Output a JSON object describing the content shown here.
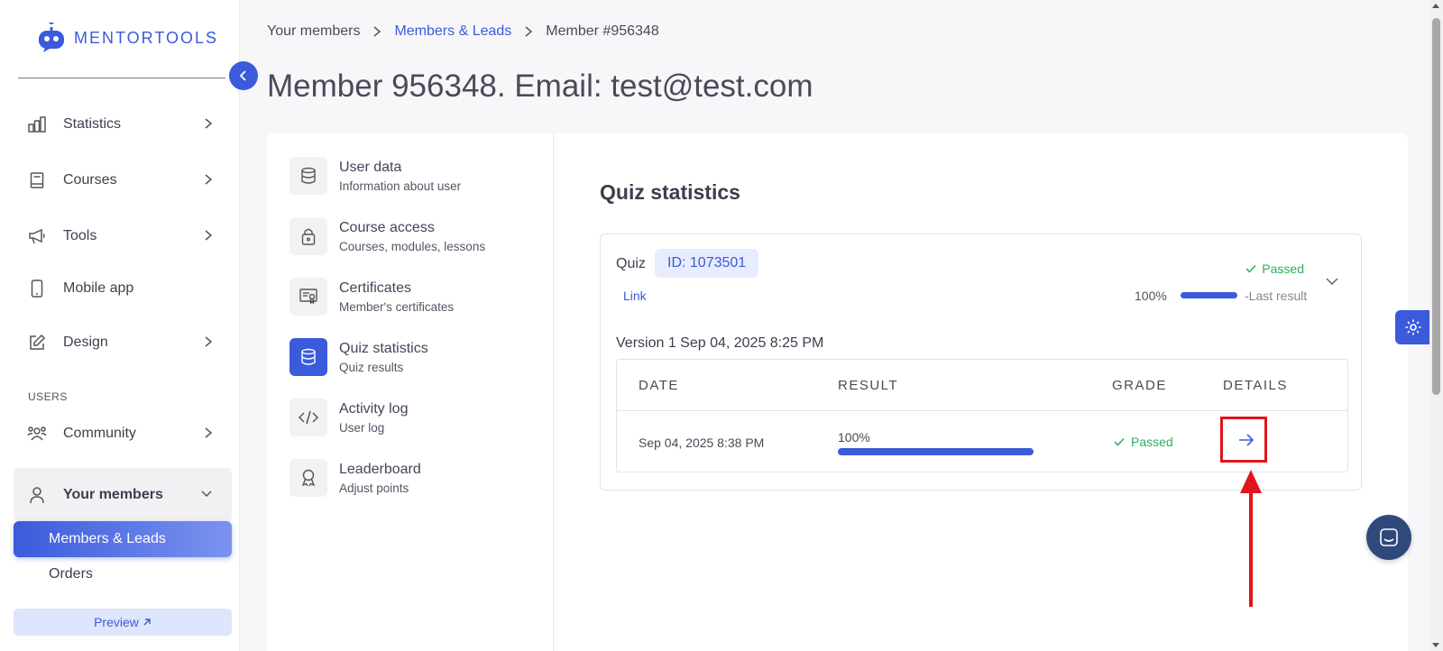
{
  "brand": {
    "name": "MENTORTOOLS"
  },
  "sidebar": {
    "items": [
      {
        "label": "Statistics",
        "icon": "bar-chart-icon"
      },
      {
        "label": "Courses",
        "icon": "book-icon"
      },
      {
        "label": "Tools",
        "icon": "megaphone-icon"
      },
      {
        "label": "Mobile app",
        "icon": "phone-icon"
      },
      {
        "label": "Design",
        "icon": "pencil-icon"
      }
    ],
    "section_label": "USERS",
    "community": {
      "label": "Community",
      "icon": "people-icon"
    },
    "members": {
      "label": "Your members",
      "icon": "user-icon"
    },
    "submenu": {
      "active": "Members & Leads",
      "other": "Orders"
    },
    "preview_label": "Preview"
  },
  "breadcrumb": {
    "root": "Your members",
    "middle": "Members & Leads",
    "current": "Member #956348"
  },
  "page_title": "Member 956348. Email: test@test.com",
  "subnav": [
    {
      "title": "User data",
      "subtitle": "Information about user",
      "icon": "database-icon"
    },
    {
      "title": "Course access",
      "subtitle": "Courses, modules, lessons",
      "icon": "lock-icon"
    },
    {
      "title": "Certificates",
      "subtitle": "Member's certificates",
      "icon": "certificate-icon"
    },
    {
      "title": "Quiz statistics",
      "subtitle": "Quiz results",
      "icon": "database-icon"
    },
    {
      "title": "Activity log",
      "subtitle": "User log",
      "icon": "code-icon"
    },
    {
      "title": "Leaderboard",
      "subtitle": "Adjust points",
      "icon": "award-icon"
    }
  ],
  "quiz": {
    "section_title": "Quiz statistics",
    "label": "Quiz",
    "id_badge": "ID: 1073501",
    "link_label": "Link",
    "status": "Passed",
    "last_percent": "100%",
    "last_progress": 1.0,
    "last_result_label": "-Last result",
    "version": "Version 1 Sep 04, 2025 8:25 PM",
    "table": {
      "headers": {
        "date": "DATE",
        "result": "RESULT",
        "grade": "GRADE",
        "details": "DETAILS"
      },
      "rows": [
        {
          "date": "Sep 04, 2025 8:38 PM",
          "result": "100%",
          "progress": 1.0,
          "grade": "Passed"
        }
      ]
    }
  },
  "colors": {
    "accent": "#3b5bdb",
    "success": "#2fae5d",
    "annotation": "#e3141b"
  }
}
